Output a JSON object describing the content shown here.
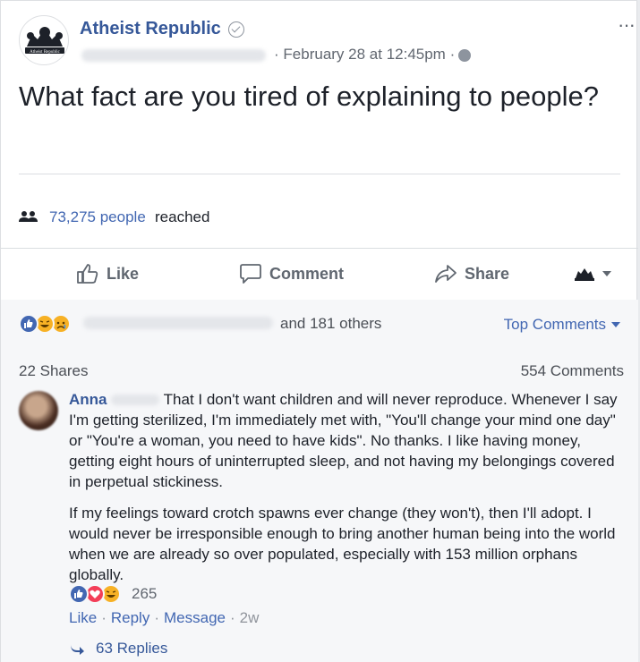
{
  "page": {
    "name": "Atheist Republic",
    "date": "February 28 at 12:45pm",
    "date_sep": "·",
    "more": "···",
    "logo_text": "Atheist Republic"
  },
  "post": {
    "text": "What fact are you tired of explaining to people?"
  },
  "reach": {
    "count": "73,275 people",
    "suffix": "reached"
  },
  "actions": {
    "like": "Like",
    "comment": "Comment",
    "share": "Share"
  },
  "reactions": {
    "others": "and 181 others",
    "top_comments": "Top Comments"
  },
  "stats": {
    "shares": "22 Shares",
    "comments": "554 Comments"
  },
  "comment": {
    "author": "Anna",
    "p1": "That I don't want children and will never reproduce. Whenever I say I'm getting sterilized, I'm immediately met with, \"You'll change your mind one day\" or \"You're a woman, you need to have kids\". No thanks. I like having money, getting eight hours of uninterrupted sleep, and not having my belongings covered in perpetual stickiness.",
    "p2": "If my feelings toward crotch spawns ever change (they won't), then I'll adopt. I would never be irresponsible enough to bring another human being into the world when we are already so over populated, especially with 153 million orphans globally.",
    "reaction_count": "265",
    "like": "Like",
    "reply": "Reply",
    "message": "Message",
    "age": "2w",
    "sep": "·",
    "replies": "63 Replies"
  },
  "colors": {
    "link": "#365899",
    "accent": "#4267b2",
    "like_blue": "#4267b2",
    "love_red": "#f33e58",
    "haha_yellow": "#f7b125"
  }
}
